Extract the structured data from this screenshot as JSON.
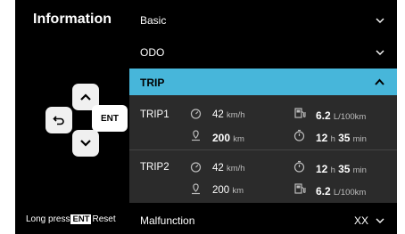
{
  "title": "Information",
  "menu": {
    "basic": "Basic",
    "odo": "ODO",
    "trip": "TRIP",
    "malfunction": "Malfunction",
    "malfunction_value": "XX"
  },
  "dpad": {
    "enter_label": "ENT"
  },
  "footnote": {
    "prefix": "Long press",
    "key": "ENT",
    "suffix": "Reset"
  },
  "trip1": {
    "name": "TRIP1",
    "avg_speed": "42",
    "avg_speed_unit": "km/h",
    "distance": "200",
    "distance_unit": "km",
    "fuel": "6.2",
    "fuel_unit": "L/100km",
    "time_h": "12",
    "time_h_unit": "h",
    "time_m": "35",
    "time_m_unit": "min"
  },
  "trip2": {
    "name": "TRIP2",
    "avg_speed": "42",
    "avg_speed_unit": "km/h",
    "distance": "200",
    "distance_unit": "km",
    "time_h": "12",
    "time_h_unit": "h",
    "time_m": "35",
    "time_m_unit": "min",
    "fuel": "6.2",
    "fuel_unit": "L/100km"
  },
  "colors": {
    "accent": "#47b6da",
    "panel": "#2b2b2b",
    "background": "#000000"
  },
  "icons": [
    "up-arrow-icon",
    "down-arrow-icon",
    "back-icon",
    "chevron-down-icon",
    "chevron-up-icon",
    "speedometer-icon",
    "location-pin-icon",
    "fuel-pump-icon",
    "stopwatch-icon"
  ]
}
